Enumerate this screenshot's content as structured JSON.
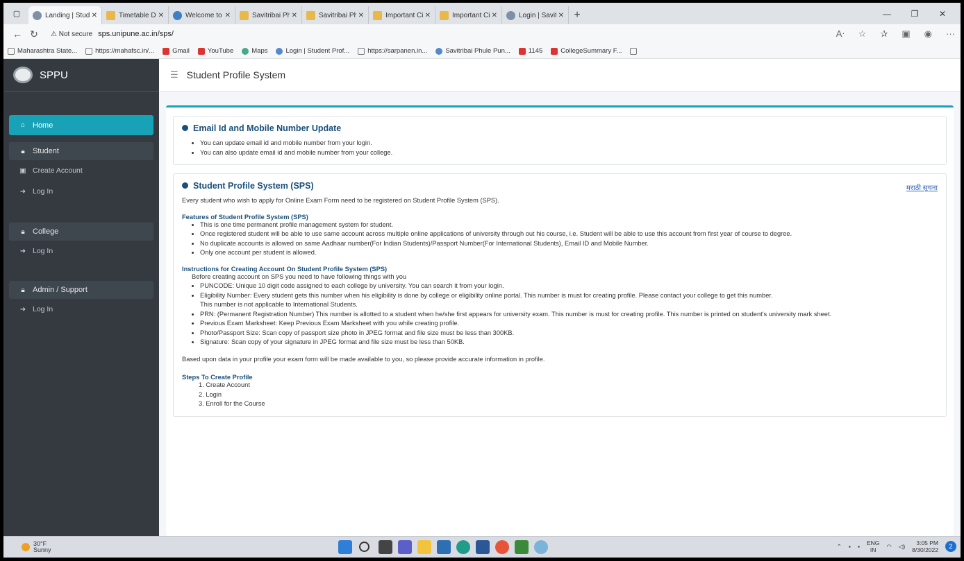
{
  "browser": {
    "tabs": [
      {
        "title": "Landing | Studen",
        "active": true
      },
      {
        "title": "Timetable DCT/S/"
      },
      {
        "title": "Welcome to Savit"
      },
      {
        "title": "Savitribai Phule P"
      },
      {
        "title": "Savitribai Phule P"
      },
      {
        "title": "Important Circul"
      },
      {
        "title": "Important Circul"
      },
      {
        "title": "Login | Savitribai"
      }
    ],
    "new_tab": "+",
    "not_secure": "Not secure",
    "url": "sps.unipune.ac.in/sps/",
    "bookmarks": [
      "Maharashtra State...",
      "https://mahafsc.in/...",
      "Gmail",
      "YouTube",
      "Maps",
      "Login | Student Prof...",
      "https://sarpanen.in...",
      "Savitribai Phule Pun...",
      "1145",
      "CollegeSummary F...",
      ""
    ]
  },
  "sidebar": {
    "brand": "SPPU",
    "home": "Home",
    "student": {
      "head": "Student",
      "items": [
        "Create Account",
        "Log In"
      ]
    },
    "college": {
      "head": "College",
      "items": [
        "Log In"
      ]
    },
    "admin": {
      "head": "Admin / Support",
      "items": [
        "Log In"
      ]
    }
  },
  "header": {
    "title": "Student Profile System"
  },
  "email_box": {
    "title": "Email Id and Mobile Number Update",
    "items": [
      "You can update email id and mobile number from your login.",
      "You can also update email id and mobile number from your college."
    ]
  },
  "sps_box": {
    "title": "Student Profile System (SPS)",
    "marathi_link": "मराठी सूचना",
    "intro": "Every student who wish to apply for Online Exam Form need to be registered on Student Profile System (SPS).",
    "features_title": "Features of Student Profile System (SPS)",
    "features": [
      "This is one time permanent profile management system for student.",
      "Once registered student will be able to use same account across multiple online applications of university through out his course, i.e. Student will be able to use this account from first year of course to degree.",
      "No duplicate accounts is allowed on same Aadhaar number(For Indian Students)/Passport Number(For International Students), Email ID and Mobile Number.",
      "Only one account per student is allowed."
    ],
    "instructions_title": "Instructions for Creating Account On Student Profile System (SPS)",
    "instructions_intro": "Before creating account on SPS you need to have following things with you",
    "instructions": [
      "PUNCODE: Unique 10 digit code assigned to each college by university. You can search it from your login.",
      "Eligibility Number: Every student gets this number when his eligibility is done by college or eligibility online portal. This number is must for creating profile. Please contact your college to get this number.",
      "PRN: (Permanent Registration Number) This number is allotted to a student when he/she first appears for university exam. This number is must for creating profile. This number is printed on student's university mark sheet.",
      "Previous Exam Marksheet: Keep Previous Exam Marksheet with you while creating profile.",
      "Photo/Passport Size: Scan copy of passport size photo in JPEG format and file size must be less than 300KB.",
      "Signature: Scan copy of your signature in JPEG format and file size must be less than 50KB."
    ],
    "intl_note": "This number is not applicable to International Students.",
    "accuracy": "Based upon data in your profile your exam form will be made available to you, so please provide accurate information in profile.",
    "steps_title": "Steps To Create Profile",
    "steps": [
      "1. Create Account",
      "2. Login",
      "3. Enroll for the Course"
    ]
  },
  "taskbar": {
    "temp": "30°F",
    "weather": "Sunny",
    "lang1": "ENG",
    "lang2": "IN",
    "time": "3:05 PM",
    "date": "8/30/2022",
    "notif": "2"
  }
}
